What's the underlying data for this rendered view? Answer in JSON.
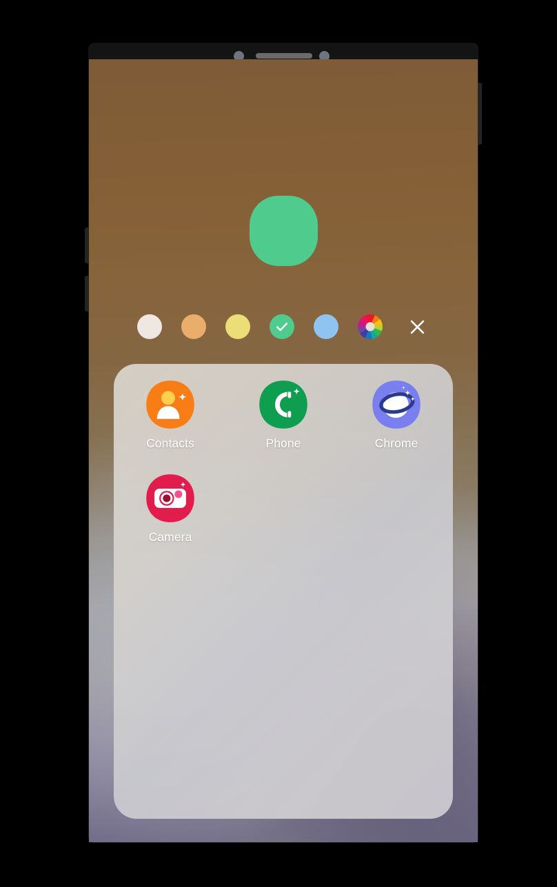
{
  "device": {
    "frame_label": "smartphone-frame",
    "sensors": {
      "camera_left": "front-camera-dot",
      "camera_right": "front-camera-dot",
      "speaker": "earpiece-speaker-grille"
    },
    "buttons": {
      "volume_up": "Volume Up",
      "volume_down": "Volume Down",
      "power": "Power"
    }
  },
  "screen": {
    "wallpaper_name": "blurred-home-wallpaper",
    "wallpaper_top_color": "#7e5c37",
    "wallpaper_bottom_color": "#6e6a86"
  },
  "icon_preview": {
    "name": "folder-color-preview",
    "color": "#4ecb8d",
    "shape": "squircle"
  },
  "color_picker": {
    "selected_index": 3,
    "selected_color": "#4ecb8d",
    "check_icon": "check-icon",
    "close_icon": "close-icon",
    "close_label": "Close",
    "swatches": [
      {
        "name": "swatch-white",
        "color": "#efe8e2",
        "label": "White",
        "selected": false
      },
      {
        "name": "swatch-tan",
        "color": "#e9ae6b",
        "label": "Tan",
        "selected": false
      },
      {
        "name": "swatch-yellow",
        "color": "#ebdd77",
        "label": "Yellow",
        "selected": false
      },
      {
        "name": "swatch-green",
        "color": "#4ecb8d",
        "label": "Green",
        "selected": true
      },
      {
        "name": "swatch-blue",
        "color": "#8fc3f0",
        "label": "Blue",
        "selected": false
      },
      {
        "name": "swatch-wheel",
        "color": "#multi",
        "label": "Color wheel",
        "selected": false
      }
    ]
  },
  "folder": {
    "name": "app-folder-panel",
    "background_color": "#d3d1ce",
    "apps": [
      {
        "name": "app-contacts",
        "label": "Contacts",
        "icon": "contacts-icon",
        "bg_color": "#f97d16",
        "fg_color": "#ffffff",
        "accent_color": "#ffd04f"
      },
      {
        "name": "app-phone",
        "label": "Phone",
        "icon": "phone-icon",
        "bg_color": "#0f9d4f",
        "fg_color": "#ffffff",
        "accent_color": "#ffffff"
      },
      {
        "name": "app-chrome",
        "label": "Chrome",
        "icon": "browser-planet-icon",
        "bg_color": "#7a7ff0",
        "fg_color": "#ffffff",
        "accent_color": "#2a3a8c"
      },
      {
        "name": "app-camera",
        "label": "Camera",
        "icon": "camera-icon",
        "bg_color": "#e31c4e",
        "fg_color": "#ffffff",
        "accent_color": "#f4528a"
      }
    ]
  }
}
